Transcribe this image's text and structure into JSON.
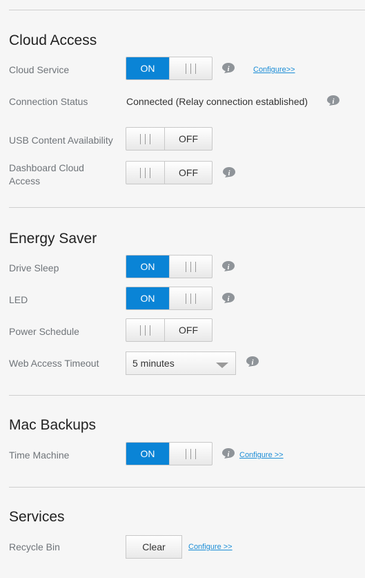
{
  "cloud_access": {
    "title": "Cloud Access",
    "cloud_service": {
      "label": "Cloud Service",
      "state": "ON",
      "link": "Configure>>"
    },
    "connection_status": {
      "label": "Connection Status",
      "value": "Connected (Relay connection established)"
    },
    "usb_content": {
      "label": "USB Content Availability",
      "state": "OFF"
    },
    "dashboard": {
      "label_line1": "Dashboard Cloud",
      "label_line2": "Access",
      "state": "OFF"
    }
  },
  "energy_saver": {
    "title": "Energy Saver",
    "drive_sleep": {
      "label": "Drive Sleep",
      "state": "ON"
    },
    "led": {
      "label": "LED",
      "state": "ON"
    },
    "power_schedule": {
      "label": "Power Schedule",
      "state": "OFF"
    },
    "web_access_timeout": {
      "label": "Web Access Timeout",
      "value": "5 minutes"
    }
  },
  "mac_backups": {
    "title": "Mac Backups",
    "time_machine": {
      "label": "Time Machine",
      "state": "ON",
      "link": "Configure >>"
    }
  },
  "services": {
    "title": "Services",
    "recycle_bin": {
      "label": "Recycle Bin",
      "button": "Clear",
      "link": "Configure >>"
    }
  },
  "icons": {
    "info": "info-icon",
    "dropdown": "chevron-down-icon"
  },
  "colors": {
    "accent": "#0a84d6",
    "link": "#1a8cd6",
    "background": "#f6f6f6"
  }
}
